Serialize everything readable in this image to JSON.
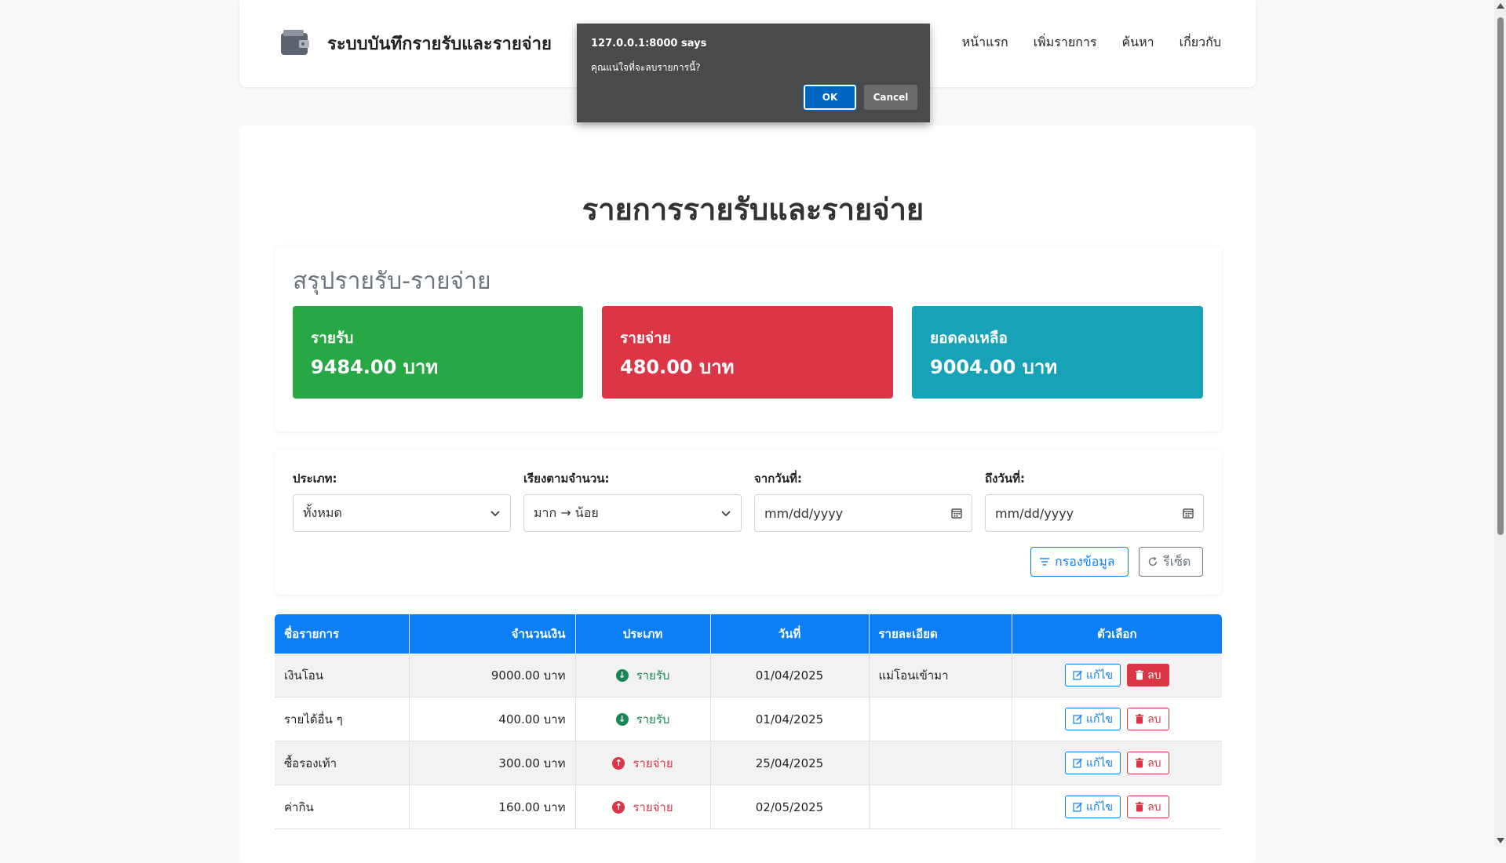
{
  "nav": {
    "brand": "ระบบบันทึกรายรับและรายจ่าย",
    "links": [
      "หน้าแรก",
      "เพิ่มรายการ",
      "ค้นหา",
      "เกี่ยวกับ"
    ]
  },
  "dialog": {
    "title": "127.0.0.1:8000 says",
    "message": "คุณแน่ใจที่จะลบรายการนี้?",
    "ok_label": "OK",
    "cancel_label": "Cancel"
  },
  "page_title": "รายการรายรับและรายจ่าย",
  "summary": {
    "title": "สรุปรายรับ-รายจ่าย",
    "income_label": "รายรับ",
    "income_value": "9484.00 บาท",
    "expense_label": "รายจ่าย",
    "expense_value": "480.00 บาท",
    "balance_label": "ยอดคงเหลือ",
    "balance_value": "9004.00 บาท",
    "colors": {
      "income": "#28a745",
      "expense": "#dc3545",
      "balance": "#17a2b8"
    }
  },
  "filters": {
    "type_label": "ประเภท:",
    "type_value": "ทั้งหมด",
    "sort_label": "เรียงตามจำนวน:",
    "sort_value": "มาก → น้อย",
    "from_label": "จากวันที่:",
    "from_placeholder": "mm/dd/yyyy",
    "to_label": "ถึงวันที่:",
    "to_placeholder": "mm/dd/yyyy",
    "filter_button": "กรองข้อมูล",
    "reset_button": "รีเซ็ต"
  },
  "table": {
    "headers": [
      "ชื่อรายการ",
      "จำนวนเงิน",
      "ประเภท",
      "วันที่",
      "รายละเอียด",
      "ตัวเลือก"
    ],
    "edit_label": "แก้ไข",
    "delete_label": "ลบ",
    "rows": [
      {
        "name": "เงินโอน",
        "amount": "9000.00 บาท",
        "type": "รายรับ",
        "kind": "income",
        "date": "01/04/2025",
        "detail": "แม่โอนเข้ามา"
      },
      {
        "name": "รายได้อื่น ๆ",
        "amount": "400.00 บาท",
        "type": "รายรับ",
        "kind": "income",
        "date": "01/04/2025",
        "detail": ""
      },
      {
        "name": "ซื้อรองเท้า",
        "amount": "300.00 บาท",
        "type": "รายจ่าย",
        "kind": "expense",
        "date": "25/04/2025",
        "detail": ""
      },
      {
        "name": "ค่ากิน",
        "amount": "160.00 บาท",
        "type": "รายจ่าย",
        "kind": "expense",
        "date": "02/05/2025",
        "detail": ""
      }
    ]
  }
}
